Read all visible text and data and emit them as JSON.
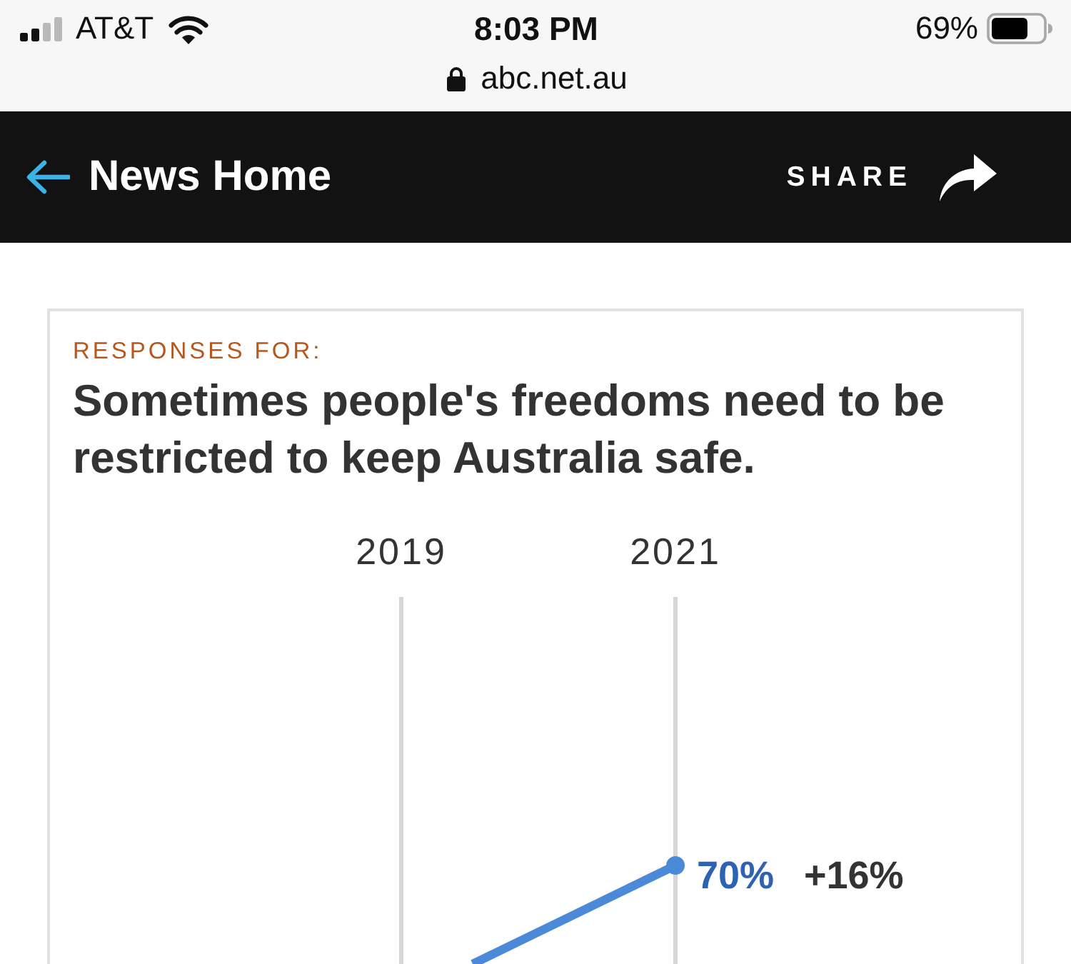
{
  "status_bar": {
    "carrier": "AT&T",
    "time": "8:03 PM",
    "battery": "69%",
    "url": "abc.net.au"
  },
  "nav_bar": {
    "back_label": "News Home",
    "share_label": "SHARE"
  },
  "card": {
    "eyebrow": "RESPONSES FOR:",
    "title": "Sometimes people's freedoms need to be restricted to keep Australia safe.",
    "chart": {
      "years": [
        "2019",
        "2021"
      ],
      "value_label": "70%",
      "change_label": "+16%"
    }
  }
}
